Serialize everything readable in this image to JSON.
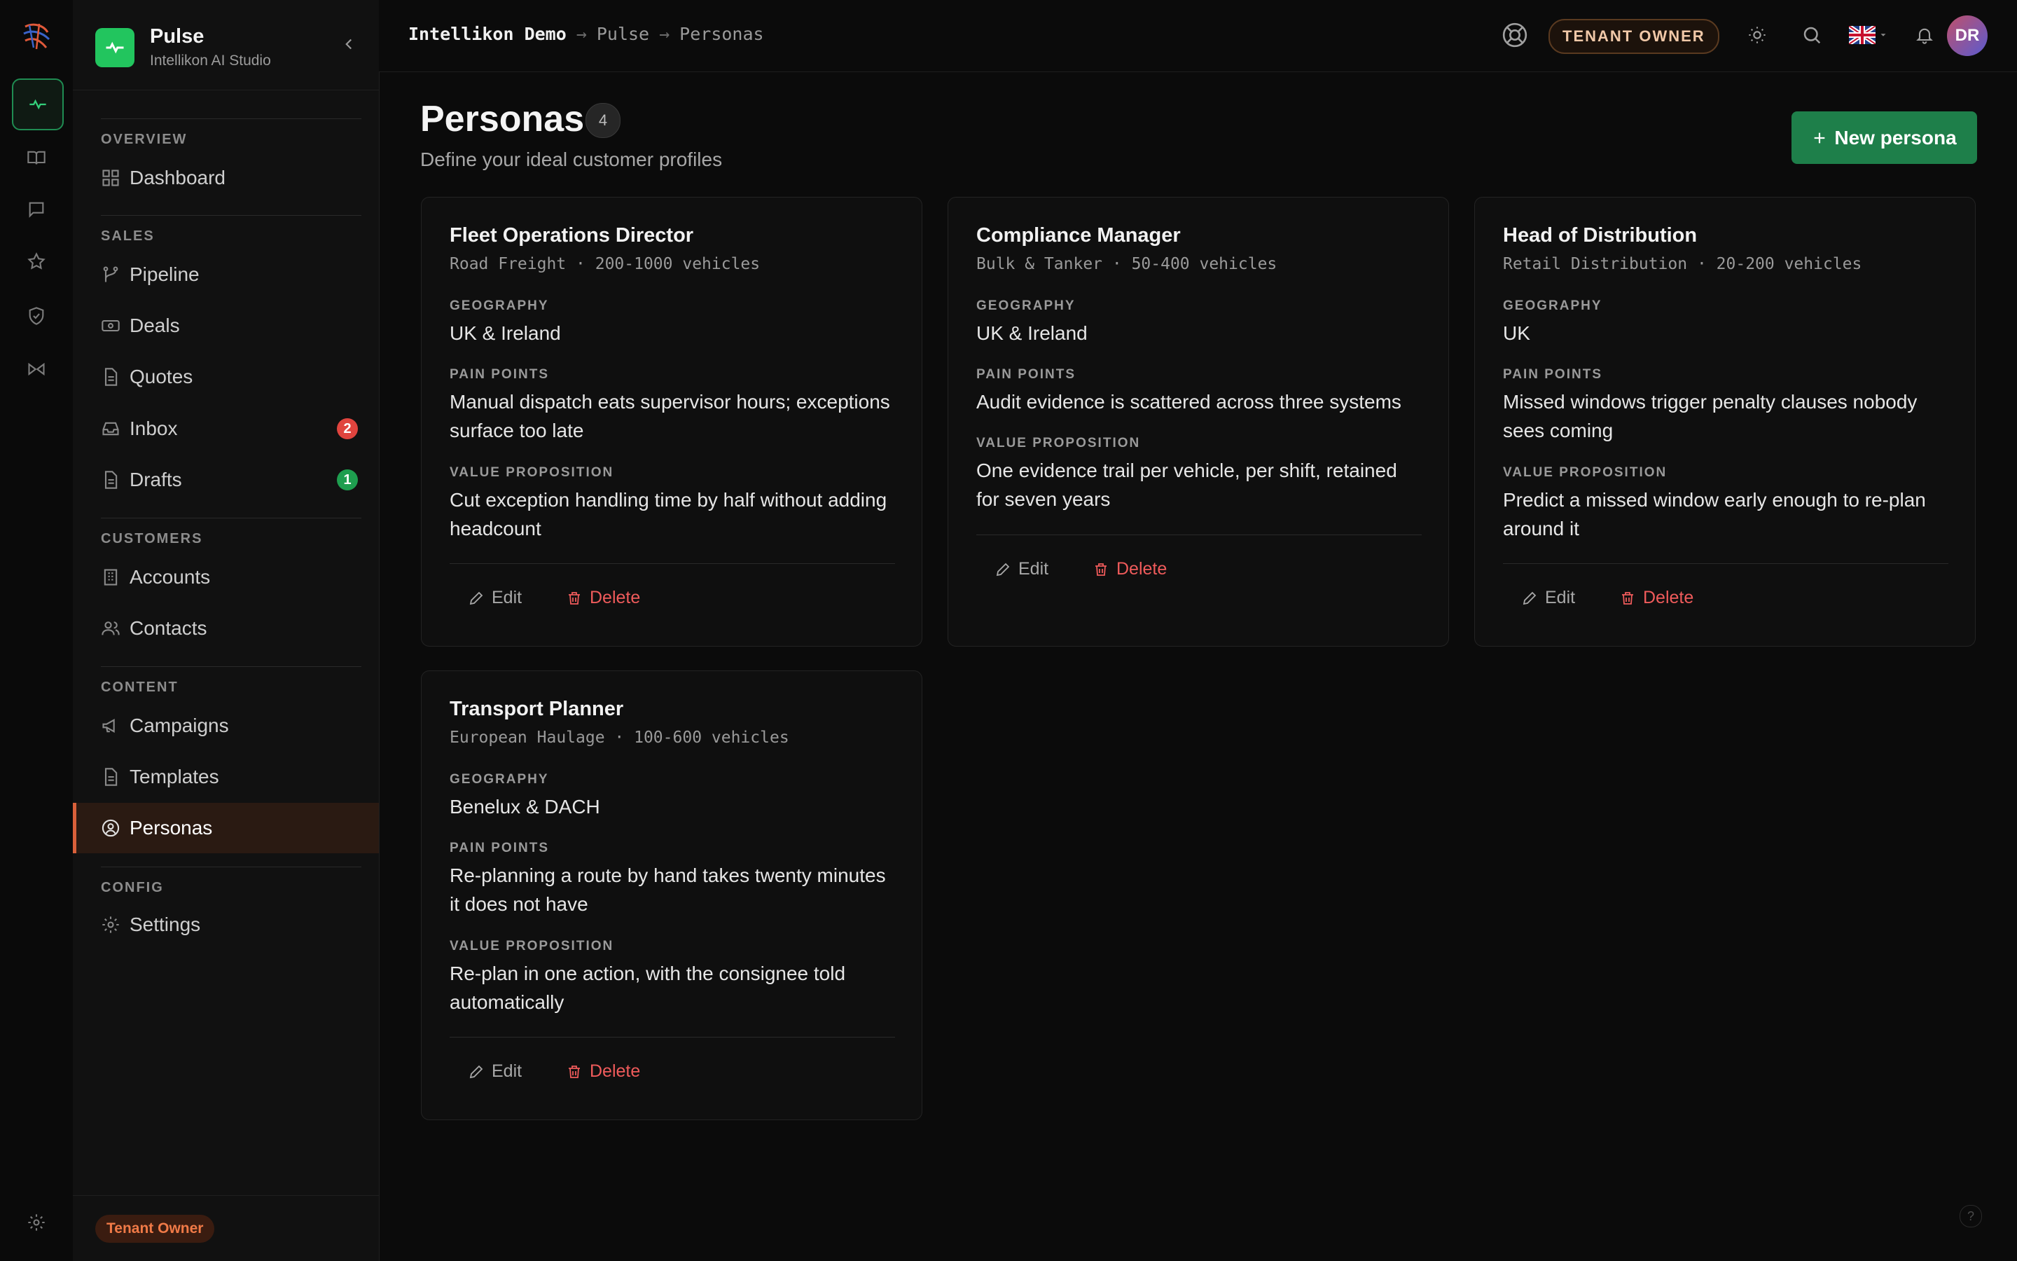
{
  "brand": {
    "name": "Pulse",
    "subtitle": "Intellikon AI Studio"
  },
  "breadcrumb": {
    "root": "Intellikon Demo",
    "sep1": "→",
    "app": "Pulse",
    "sep2": "→",
    "current": "Personas"
  },
  "header": {
    "role": "TENANT OWNER",
    "avatar_initials": "DR",
    "language_flag": "uk-flag-icon"
  },
  "sidebar": {
    "sections": {
      "overview": "OVERVIEW",
      "sales": "SALES",
      "customers": "CUSTOMERS",
      "content": "CONTENT",
      "config": "CONFIG"
    },
    "items": {
      "dashboard": "Dashboard",
      "pipeline": "Pipeline",
      "deals": "Deals",
      "quotes": "Quotes",
      "inbox": "Inbox",
      "inbox_badge": "2",
      "drafts": "Drafts",
      "drafts_badge": "1",
      "accounts": "Accounts",
      "contacts": "Contacts",
      "campaigns": "Campaigns",
      "templates": "Templates",
      "personas": "Personas",
      "settings": "Settings"
    },
    "footer_pill": "Tenant Owner"
  },
  "page": {
    "title": "Personas",
    "count": "4",
    "subtitle": "Define your ideal customer profiles",
    "new_button": "New persona"
  },
  "labels": {
    "geography": "GEOGRAPHY",
    "pain_points": "PAIN POINTS",
    "value_proposition": "VALUE PROPOSITION",
    "edit": "Edit",
    "delete": "Delete"
  },
  "personas": [
    {
      "name": "Fleet Operations Director",
      "segment": "Road Freight",
      "fleet": "200-1000 vehicles",
      "geography": "UK & Ireland",
      "pain_points": "Manual dispatch eats supervisor hours; exceptions surface too late",
      "value_proposition": "Cut exception handling time by half without adding headcount"
    },
    {
      "name": "Compliance Manager",
      "segment": "Bulk & Tanker",
      "fleet": "50-400 vehicles",
      "geography": "UK & Ireland",
      "pain_points": "Audit evidence is scattered across three systems",
      "value_proposition": "One evidence trail per vehicle, per shift, retained for seven years"
    },
    {
      "name": "Head of Distribution",
      "segment": "Retail Distribution",
      "fleet": "20-200 vehicles",
      "geography": "UK",
      "pain_points": "Missed windows trigger penalty clauses nobody sees coming",
      "value_proposition": "Predict a missed window early enough to re-plan around it"
    },
    {
      "name": "Transport Planner",
      "segment": "European Haulage",
      "fleet": "100-600 vehicles",
      "geography": "Benelux & DACH",
      "pain_points": "Re-planning a route by hand takes twenty minutes it does not have",
      "value_proposition": "Re-plan in one action, with the consignee told automatically"
    }
  ],
  "colors": {
    "accent_green": "#1e7f4a",
    "danger": "#ef5b5b",
    "active_nav": "#d9603a",
    "brand_green": "#22c55e"
  },
  "help_mark": "?"
}
